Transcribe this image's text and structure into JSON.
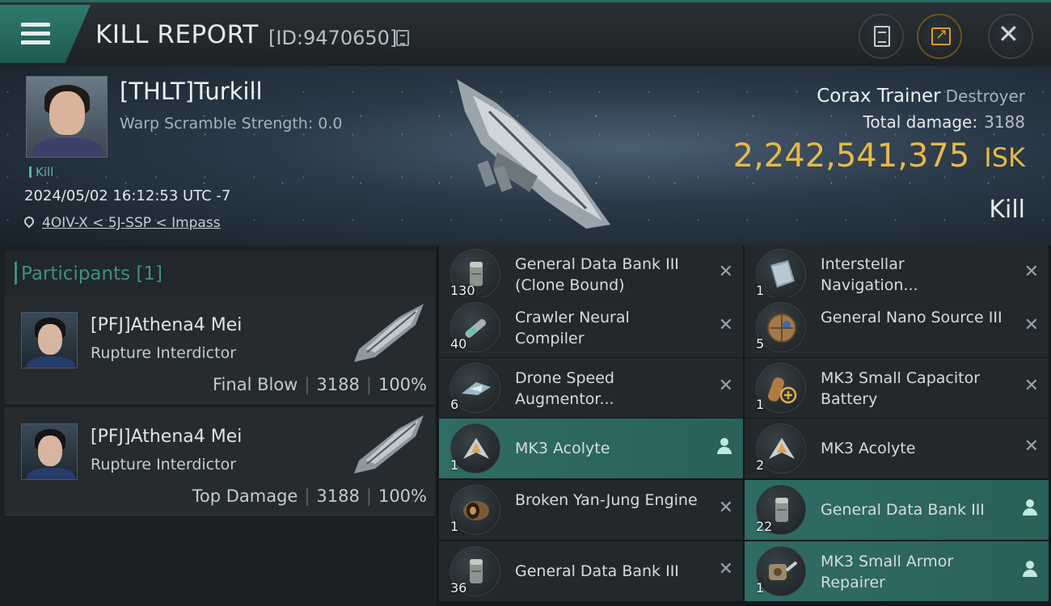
{
  "header": {
    "title": "KILL REPORT",
    "kill_id": "[ID:9470650]"
  },
  "victim": {
    "name": "[THLT]Turkill",
    "warp_scramble": "Warp Scramble Strength: 0.0",
    "tag": "Kill",
    "timestamp": "2024/05/02 16:12:53 UTC -7",
    "location": "4OIV-X < 5J-SSP < Impass",
    "ship": "Corax Trainer",
    "ship_class": "Destroyer",
    "total_damage_label": "Total damage:",
    "total_damage": "3188",
    "isk_value": "2,242,541,375",
    "isk_unit": "ISK",
    "result": "Kill"
  },
  "participants_panel": {
    "title": "Participants [1]",
    "items": [
      {
        "name": "[PFJ]Athena4 Mei",
        "ship": "Rupture Interdictor",
        "role": "Final Blow",
        "damage": "3188",
        "percent": "100%"
      },
      {
        "name": "[PFJ]Athena4 Mei",
        "ship": "Rupture Interdictor",
        "role": "Top Damage",
        "damage": "3188",
        "percent": "100%"
      }
    ]
  },
  "items": [
    {
      "qty": "130",
      "name": "General Data Bank III (Clone Bound)",
      "state": "destroyed",
      "icon": "data-bank-icon"
    },
    {
      "qty": "1",
      "name": "Interstellar Navigation...",
      "state": "destroyed",
      "icon": "book-icon"
    },
    {
      "qty": "40",
      "name": "Crawler Neural Compiler",
      "state": "destroyed",
      "icon": "syringe-icon"
    },
    {
      "qty": "5",
      "name": "General Nano Source III",
      "state": "destroyed",
      "icon": "nano-sphere-icon"
    },
    {
      "qty": "6",
      "name": "Drone Speed Augmentor...",
      "state": "destroyed",
      "icon": "augmentor-icon"
    },
    {
      "qty": "1",
      "name": "MK3 Small Capacitor Battery",
      "state": "destroyed",
      "icon": "capacitor-icon"
    },
    {
      "qty": "1",
      "name": "MK3  Acolyte",
      "state": "dropped",
      "icon": "drone-icon"
    },
    {
      "qty": "2",
      "name": "MK3  Acolyte",
      "state": "destroyed",
      "icon": "drone-icon"
    },
    {
      "qty": "1",
      "name": "Broken Yan-Jung Engine",
      "state": "destroyed",
      "icon": "engine-icon"
    },
    {
      "qty": "22",
      "name": "General Data Bank III",
      "state": "dropped",
      "icon": "data-bank-icon"
    },
    {
      "qty": "36",
      "name": "General Data Bank III",
      "state": "destroyed",
      "icon": "data-bank-icon"
    },
    {
      "qty": "1",
      "name": "MK3 Small Armor Repairer",
      "state": "dropped",
      "icon": "armor-repairer-icon"
    }
  ],
  "colors": {
    "accent_teal": "#2f7a70",
    "isk_gold": "#e8b94a",
    "dropped_row": "#2f6c65"
  }
}
